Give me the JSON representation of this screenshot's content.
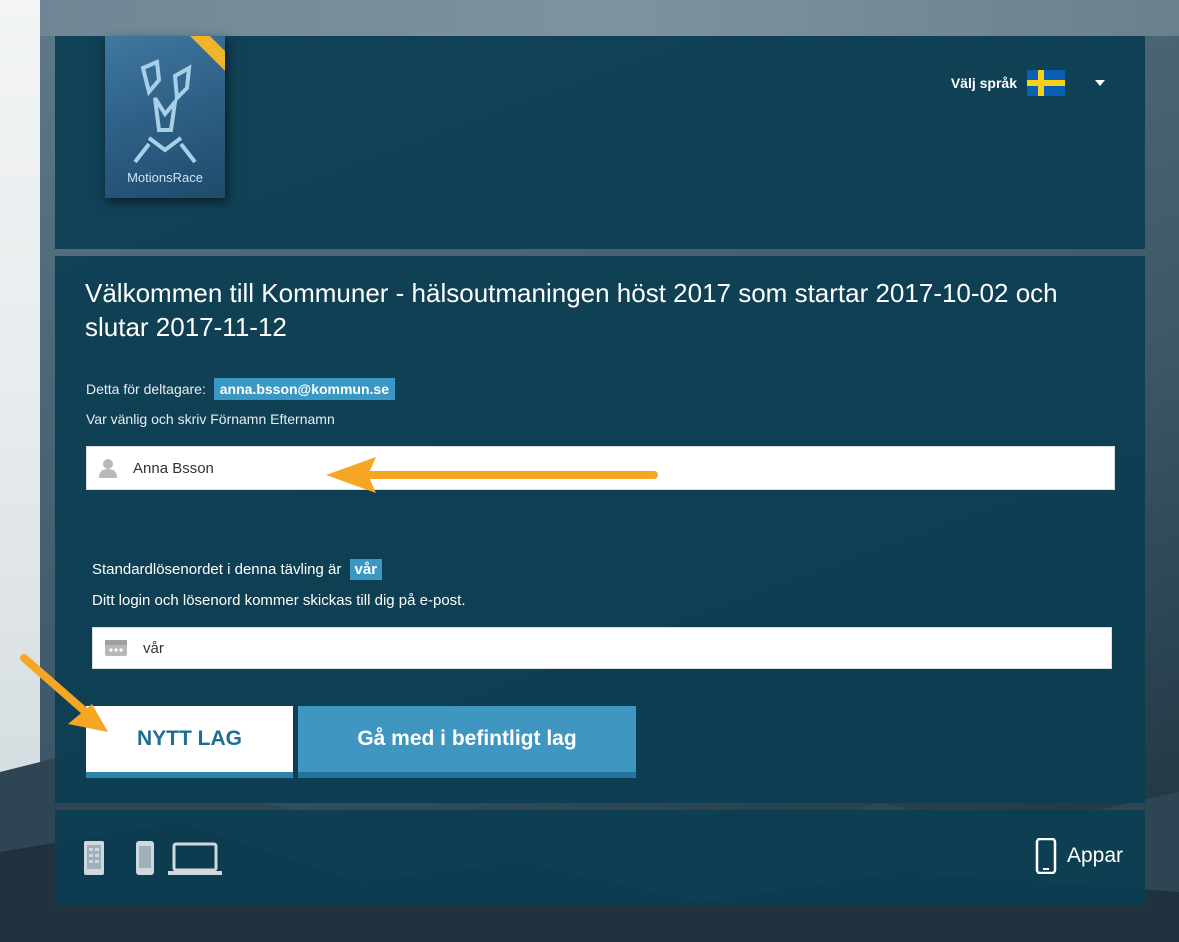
{
  "logo": {
    "text": "MotionsRace"
  },
  "language": {
    "label": "Välj språk",
    "flag_icon": "sweden-flag-icon"
  },
  "main": {
    "title": "Välkommen till Kommuner - hälsoutmaningen höst 2017 som startar 2017-10-02 och slutar 2017-11-12",
    "participant_prefix": "Detta för deltagare:",
    "participant_email": "anna.bsson@kommun.se",
    "name_instruction": "Var vänlig och skriv Förnamn Efternamn",
    "name_value": "Anna Bsson",
    "password_prefix": "Standardlösenordet i denna tävling är",
    "password_highlight": "vår",
    "password_info": "Ditt login och lösenord kommer skickas till dig på e-post.",
    "password_value": "vår"
  },
  "buttons": {
    "new_team": "NYTT LAG",
    "join_team": "Gå med i befintligt lag"
  },
  "footer": {
    "device_icons": [
      "tablet-icon",
      "phone-icon",
      "laptop-icon"
    ],
    "apps_label": "Appar",
    "apps_icon": "smartphone-icon"
  },
  "colors": {
    "panel": "#0c3d52",
    "accent": "#3a98c5",
    "annotation_arrow": "#f5a623"
  }
}
